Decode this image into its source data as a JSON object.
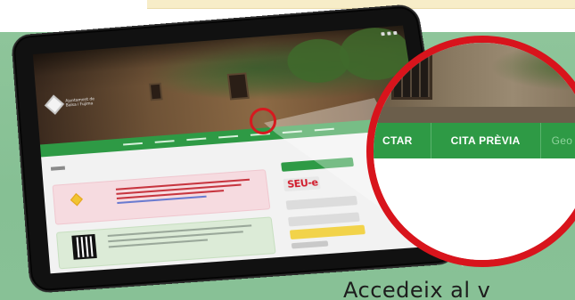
{
  "caption": "Accedeix al v",
  "tablet": {
    "logo_text": "Ajuntament de\nBalsa i Fujima"
  },
  "tablet_sidebar": {
    "seu_logo": "SEU-e"
  },
  "zoom": {
    "nav_items": [
      "CTAR",
      "CITA PRÈVIA",
      "Geo"
    ]
  },
  "colors": {
    "green_panel": "#88c196",
    "nav_green": "#2e9a45",
    "highlight_red": "#d6191f"
  },
  "icons": [
    "logo-mark-icon",
    "qr-code-icon"
  ]
}
